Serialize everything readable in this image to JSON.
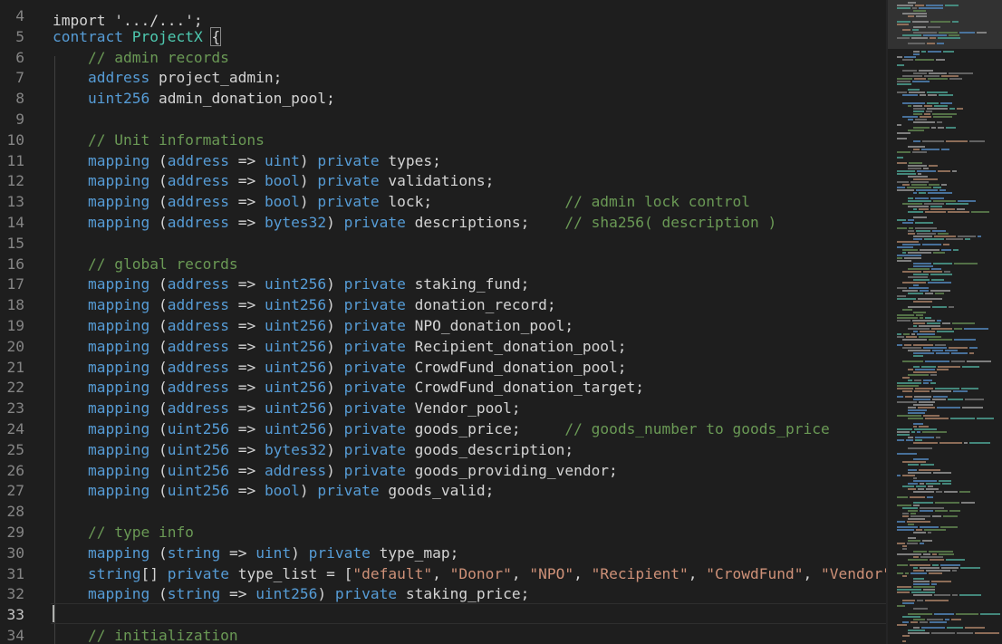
{
  "editor": {
    "top_partial_line": "import '.../...';",
    "colors": {
      "keyword": "#569cd6",
      "type": "#4ec9b0",
      "comment": "#6a9955",
      "string": "#ce9178",
      "identifier": "#d4d4d4",
      "line_number": "#858585",
      "background": "#1e1e1e"
    },
    "lines": [
      {
        "n": "4",
        "tokens": []
      },
      {
        "n": "5",
        "tokens": [
          [
            "kw",
            "contract"
          ],
          [
            "id",
            " "
          ],
          [
            "type",
            "ProjectX"
          ],
          [
            "id",
            " "
          ],
          [
            "bracket",
            "{"
          ]
        ]
      },
      {
        "n": "6",
        "tokens": [
          [
            "id",
            "    "
          ],
          [
            "cm",
            "// admin records"
          ]
        ]
      },
      {
        "n": "7",
        "tokens": [
          [
            "id",
            "    "
          ],
          [
            "kw",
            "address"
          ],
          [
            "id",
            " project_admin;"
          ]
        ]
      },
      {
        "n": "8",
        "tokens": [
          [
            "id",
            "    "
          ],
          [
            "kw",
            "uint256"
          ],
          [
            "id",
            " admin_donation_pool;"
          ]
        ]
      },
      {
        "n": "9",
        "tokens": []
      },
      {
        "n": "10",
        "tokens": [
          [
            "id",
            "    "
          ],
          [
            "cm",
            "// Unit informations"
          ]
        ]
      },
      {
        "n": "11",
        "tokens": [
          [
            "id",
            "    "
          ],
          [
            "kw",
            "mapping"
          ],
          [
            "id",
            " ("
          ],
          [
            "kw",
            "address"
          ],
          [
            "id",
            " => "
          ],
          [
            "kw",
            "uint"
          ],
          [
            "id",
            ") "
          ],
          [
            "kw",
            "private"
          ],
          [
            "id",
            " types;"
          ]
        ]
      },
      {
        "n": "12",
        "tokens": [
          [
            "id",
            "    "
          ],
          [
            "kw",
            "mapping"
          ],
          [
            "id",
            " ("
          ],
          [
            "kw",
            "address"
          ],
          [
            "id",
            " => "
          ],
          [
            "kw",
            "bool"
          ],
          [
            "id",
            ") "
          ],
          [
            "kw",
            "private"
          ],
          [
            "id",
            " validations;"
          ]
        ]
      },
      {
        "n": "13",
        "tokens": [
          [
            "id",
            "    "
          ],
          [
            "kw",
            "mapping"
          ],
          [
            "id",
            " ("
          ],
          [
            "kw",
            "address"
          ],
          [
            "id",
            " => "
          ],
          [
            "kw",
            "bool"
          ],
          [
            "id",
            ") "
          ],
          [
            "kw",
            "private"
          ],
          [
            "id",
            " lock;               "
          ],
          [
            "cm",
            "// admin lock control"
          ]
        ]
      },
      {
        "n": "14",
        "tokens": [
          [
            "id",
            "    "
          ],
          [
            "kw",
            "mapping"
          ],
          [
            "id",
            " ("
          ],
          [
            "kw",
            "address"
          ],
          [
            "id",
            " => "
          ],
          [
            "kw",
            "bytes32"
          ],
          [
            "id",
            ") "
          ],
          [
            "kw",
            "private"
          ],
          [
            "id",
            " descriptions;    "
          ],
          [
            "cm",
            "// sha256( description )"
          ]
        ]
      },
      {
        "n": "15",
        "tokens": []
      },
      {
        "n": "16",
        "tokens": [
          [
            "id",
            "    "
          ],
          [
            "cm",
            "// global records"
          ]
        ]
      },
      {
        "n": "17",
        "tokens": [
          [
            "id",
            "    "
          ],
          [
            "kw",
            "mapping"
          ],
          [
            "id",
            " ("
          ],
          [
            "kw",
            "address"
          ],
          [
            "id",
            " => "
          ],
          [
            "kw",
            "uint256"
          ],
          [
            "id",
            ") "
          ],
          [
            "kw",
            "private"
          ],
          [
            "id",
            " staking_fund;"
          ]
        ]
      },
      {
        "n": "18",
        "tokens": [
          [
            "id",
            "    "
          ],
          [
            "kw",
            "mapping"
          ],
          [
            "id",
            " ("
          ],
          [
            "kw",
            "address"
          ],
          [
            "id",
            " => "
          ],
          [
            "kw",
            "uint256"
          ],
          [
            "id",
            ") "
          ],
          [
            "kw",
            "private"
          ],
          [
            "id",
            " donation_record;"
          ]
        ]
      },
      {
        "n": "19",
        "tokens": [
          [
            "id",
            "    "
          ],
          [
            "kw",
            "mapping"
          ],
          [
            "id",
            " ("
          ],
          [
            "kw",
            "address"
          ],
          [
            "id",
            " => "
          ],
          [
            "kw",
            "uint256"
          ],
          [
            "id",
            ") "
          ],
          [
            "kw",
            "private"
          ],
          [
            "id",
            " NPO_donation_pool;"
          ]
        ]
      },
      {
        "n": "20",
        "tokens": [
          [
            "id",
            "    "
          ],
          [
            "kw",
            "mapping"
          ],
          [
            "id",
            " ("
          ],
          [
            "kw",
            "address"
          ],
          [
            "id",
            " => "
          ],
          [
            "kw",
            "uint256"
          ],
          [
            "id",
            ") "
          ],
          [
            "kw",
            "private"
          ],
          [
            "id",
            " Recipient_donation_pool;"
          ]
        ]
      },
      {
        "n": "21",
        "tokens": [
          [
            "id",
            "    "
          ],
          [
            "kw",
            "mapping"
          ],
          [
            "id",
            " ("
          ],
          [
            "kw",
            "address"
          ],
          [
            "id",
            " => "
          ],
          [
            "kw",
            "uint256"
          ],
          [
            "id",
            ") "
          ],
          [
            "kw",
            "private"
          ],
          [
            "id",
            " CrowdFund_donation_pool;"
          ]
        ]
      },
      {
        "n": "22",
        "tokens": [
          [
            "id",
            "    "
          ],
          [
            "kw",
            "mapping"
          ],
          [
            "id",
            " ("
          ],
          [
            "kw",
            "address"
          ],
          [
            "id",
            " => "
          ],
          [
            "kw",
            "uint256"
          ],
          [
            "id",
            ") "
          ],
          [
            "kw",
            "private"
          ],
          [
            "id",
            " CrowdFund_donation_target;"
          ]
        ]
      },
      {
        "n": "23",
        "tokens": [
          [
            "id",
            "    "
          ],
          [
            "kw",
            "mapping"
          ],
          [
            "id",
            " ("
          ],
          [
            "kw",
            "address"
          ],
          [
            "id",
            " => "
          ],
          [
            "kw",
            "uint256"
          ],
          [
            "id",
            ") "
          ],
          [
            "kw",
            "private"
          ],
          [
            "id",
            " Vendor_pool;"
          ]
        ]
      },
      {
        "n": "24",
        "tokens": [
          [
            "id",
            "    "
          ],
          [
            "kw",
            "mapping"
          ],
          [
            "id",
            " ("
          ],
          [
            "kw",
            "uint256"
          ],
          [
            "id",
            " => "
          ],
          [
            "kw",
            "uint256"
          ],
          [
            "id",
            ") "
          ],
          [
            "kw",
            "private"
          ],
          [
            "id",
            " goods_price;     "
          ],
          [
            "cm",
            "// goods_number to goods_price"
          ]
        ]
      },
      {
        "n": "25",
        "tokens": [
          [
            "id",
            "    "
          ],
          [
            "kw",
            "mapping"
          ],
          [
            "id",
            " ("
          ],
          [
            "kw",
            "uint256"
          ],
          [
            "id",
            " => "
          ],
          [
            "kw",
            "bytes32"
          ],
          [
            "id",
            ") "
          ],
          [
            "kw",
            "private"
          ],
          [
            "id",
            " goods_description;"
          ]
        ]
      },
      {
        "n": "26",
        "tokens": [
          [
            "id",
            "    "
          ],
          [
            "kw",
            "mapping"
          ],
          [
            "id",
            " ("
          ],
          [
            "kw",
            "uint256"
          ],
          [
            "id",
            " => "
          ],
          [
            "kw",
            "address"
          ],
          [
            "id",
            ") "
          ],
          [
            "kw",
            "private"
          ],
          [
            "id",
            " goods_providing_vendor;"
          ]
        ]
      },
      {
        "n": "27",
        "tokens": [
          [
            "id",
            "    "
          ],
          [
            "kw",
            "mapping"
          ],
          [
            "id",
            " ("
          ],
          [
            "kw",
            "uint256"
          ],
          [
            "id",
            " => "
          ],
          [
            "kw",
            "bool"
          ],
          [
            "id",
            ") "
          ],
          [
            "kw",
            "private"
          ],
          [
            "id",
            " goods_valid;"
          ]
        ]
      },
      {
        "n": "28",
        "tokens": []
      },
      {
        "n": "29",
        "tokens": [
          [
            "id",
            "    "
          ],
          [
            "cm",
            "// type info"
          ]
        ]
      },
      {
        "n": "30",
        "tokens": [
          [
            "id",
            "    "
          ],
          [
            "kw",
            "mapping"
          ],
          [
            "id",
            " ("
          ],
          [
            "kw",
            "string"
          ],
          [
            "id",
            " => "
          ],
          [
            "kw",
            "uint"
          ],
          [
            "id",
            ") "
          ],
          [
            "kw",
            "private"
          ],
          [
            "id",
            " type_map;"
          ]
        ]
      },
      {
        "n": "31",
        "tokens": [
          [
            "id",
            "    "
          ],
          [
            "kw",
            "string"
          ],
          [
            "id",
            "[] "
          ],
          [
            "kw",
            "private"
          ],
          [
            "id",
            " type_list = ["
          ],
          [
            "str",
            "\"default\""
          ],
          [
            "id",
            ", "
          ],
          [
            "str",
            "\"Donor\""
          ],
          [
            "id",
            ", "
          ],
          [
            "str",
            "\"NPO\""
          ],
          [
            "id",
            ", "
          ],
          [
            "str",
            "\"Recipient\""
          ],
          [
            "id",
            ", "
          ],
          [
            "str",
            "\"CrowdFund\""
          ],
          [
            "id",
            ", "
          ],
          [
            "str",
            "\"Vendor\""
          ],
          [
            "id",
            "];"
          ]
        ]
      },
      {
        "n": "32",
        "tokens": [
          [
            "id",
            "    "
          ],
          [
            "kw",
            "mapping"
          ],
          [
            "id",
            " ("
          ],
          [
            "kw",
            "string"
          ],
          [
            "id",
            " => "
          ],
          [
            "kw",
            "uint256"
          ],
          [
            "id",
            ") "
          ],
          [
            "kw",
            "private"
          ],
          [
            "id",
            " staking_price;"
          ]
        ]
      },
      {
        "n": "33",
        "tokens": []
      },
      {
        "n": "34",
        "tokens": [
          [
            "id",
            "    "
          ],
          [
            "cm",
            "// initialization"
          ]
        ]
      }
    ]
  }
}
